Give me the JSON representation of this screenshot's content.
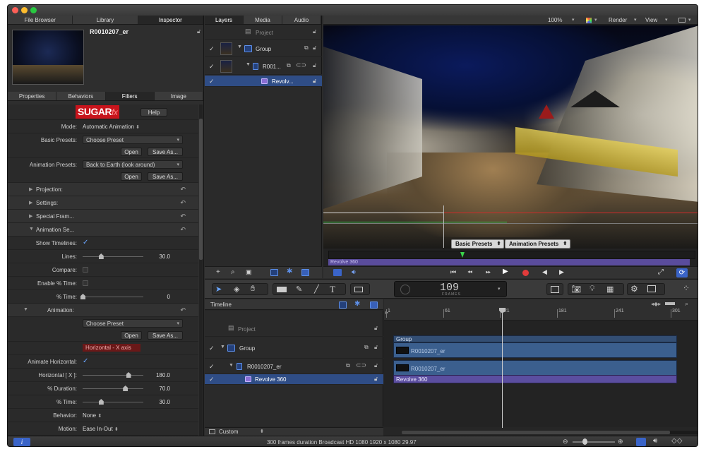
{
  "window": {
    "left_tabs": [
      "File Browser",
      "Library",
      "Inspector"
    ],
    "selected_name": "R0010207_er",
    "inspector_tabs": [
      "Properties",
      "Behaviors",
      "Filters",
      "Image"
    ]
  },
  "inspector": {
    "logo_main": "SUGAR",
    "logo_sub": "fx",
    "help_label": "Help",
    "mode_label": "Mode:",
    "mode_value": "Automatic Animation",
    "basic_presets_label": "Basic Presets:",
    "basic_presets_value": "Choose Preset",
    "open_label": "Open",
    "save_as_label": "Save As...",
    "animation_presets_label": "Animation Presets:",
    "animation_presets_value": "Back to Earth (look around)",
    "sections": [
      "Projection:",
      "Settings:",
      "Special Fram...",
      "Animation Se..."
    ],
    "show_timelines_label": "Show Timelines:",
    "lines_label": "Lines:",
    "lines_value": "30.0",
    "lines_level": 0.3,
    "compare_label": "Compare:",
    "enable_pct_time_label": "Enable % Time:",
    "pct_time_label": "% Time:",
    "pct_time_value": "0",
    "animation_section_label": "Animation:",
    "animation_preset_value": "Choose Preset",
    "horizontal_axis_label": "Horizontal - X axis",
    "animate_horizontal_label": "Animate Horizontal:",
    "horizontal_x_label": "Horizontal [ X ]:",
    "horizontal_x_value": "180.0",
    "horizontal_x_level": 0.75,
    "pct_duration_label": "% Duration:",
    "pct_duration_value": "70.0",
    "pct_duration_level": 0.7,
    "pct_time2_label": "% Time:",
    "pct_time2_value": "30.0",
    "pct_time2_level": 0.3,
    "behavior_label": "Behavior:",
    "behavior_value": "None",
    "motion_label": "Motion:",
    "motion_value": "Ease In-Out"
  },
  "layers_panel": {
    "tabs": [
      "Layers",
      "Media",
      "Audio"
    ],
    "rows": [
      "Project",
      "Group",
      "R001...",
      "Revolv..."
    ]
  },
  "viewer": {
    "zoom": "100%",
    "render_label": "Render",
    "view_label": "View",
    "basic_presets_btn": "Basic Presets",
    "animation_presets_btn": "Animation Presets",
    "mini_track_label": "Revolve 360"
  },
  "toolbar": {
    "frame_count": "109",
    "frame_unit": "FRAMES"
  },
  "timeline": {
    "title": "Timeline",
    "rows": [
      "Project",
      "Group",
      "R0010207_er",
      "Revolve 360"
    ],
    "footer_label": "Custom",
    "ruler_ticks": [
      "1",
      "61",
      "121",
      "181",
      "241",
      "301"
    ],
    "tracks": [
      "Group",
      "R0010207_er",
      "R0010207_er",
      "Revolve 360"
    ]
  },
  "status": {
    "text": "300 frames duration Broadcast HD 1080 1920 x 1080 29.97"
  },
  "colors": {
    "selection": "#2f4d86",
    "accent_blue": "#4a7fe0",
    "sugar_red": "#c8141c",
    "track_blue": "#3b5f8e",
    "track_purple": "#5b4ea0"
  }
}
